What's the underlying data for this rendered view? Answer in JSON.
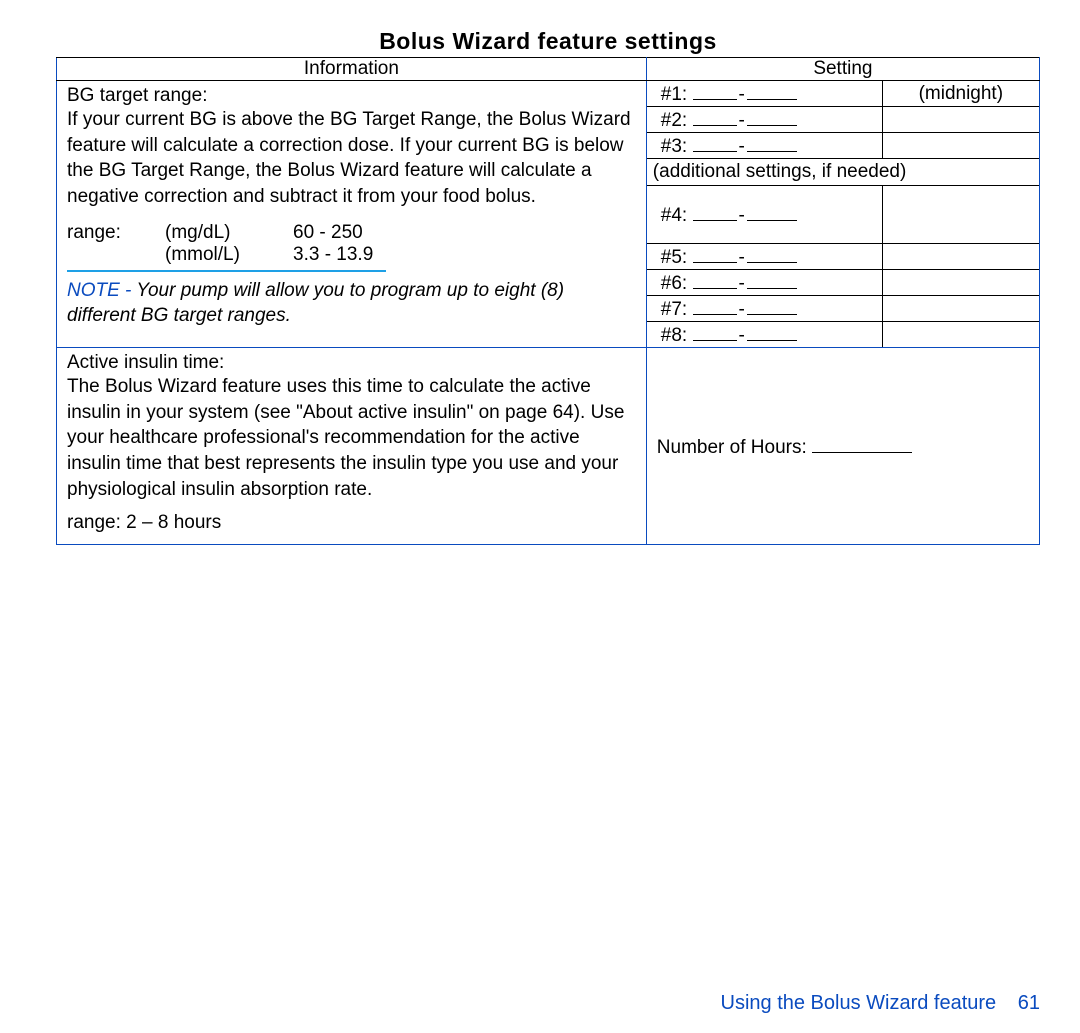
{
  "title": "Bolus Wizard feature settings",
  "colheaders": {
    "info": "Information",
    "setting": "Setting"
  },
  "bg": {
    "label": "BG target range:",
    "desc": "If your current BG is above the BG Target Range, the Bolus Wizard feature will calculate a correction dose. If your current BG is below the BG Target Range, the Bolus Wizard feature will calculate a negative correction and subtract it from your food bolus.",
    "range_label": "range:",
    "mgdl_label": "(mg/dL)",
    "mgdl_value": "60 - 250",
    "mmol_label": "(mmol/L)",
    "mmol_value": "3.3 - 13.9",
    "note_prefix": "NOTE - ",
    "note_body": "Your pump will allow you to program up to eight (8) different BG target ranges.",
    "slot1": "#1:",
    "slot1_extra": "(midnight)",
    "slot2": "#2:",
    "slot3": "#3:",
    "additional": "(additional settings, if needed)",
    "slot4": "#4:",
    "slot5": "#5:",
    "slot6": "#6:",
    "slot7": "#7:",
    "slot8": "#8:"
  },
  "ait": {
    "label": "Active insulin time:",
    "desc": "The Bolus Wizard feature uses this time to calculate the active insulin in your system (see \"About active insulin\" on page 64). Use your healthcare professional's recommendation for the active insulin time that best represents the insulin type you use and your physiological insulin absorption rate.",
    "range": "range:  2 – 8 hours",
    "hours_label": "Number of Hours:"
  },
  "footer": {
    "chapter": "Using the Bolus Wizard feature",
    "page": "61"
  }
}
